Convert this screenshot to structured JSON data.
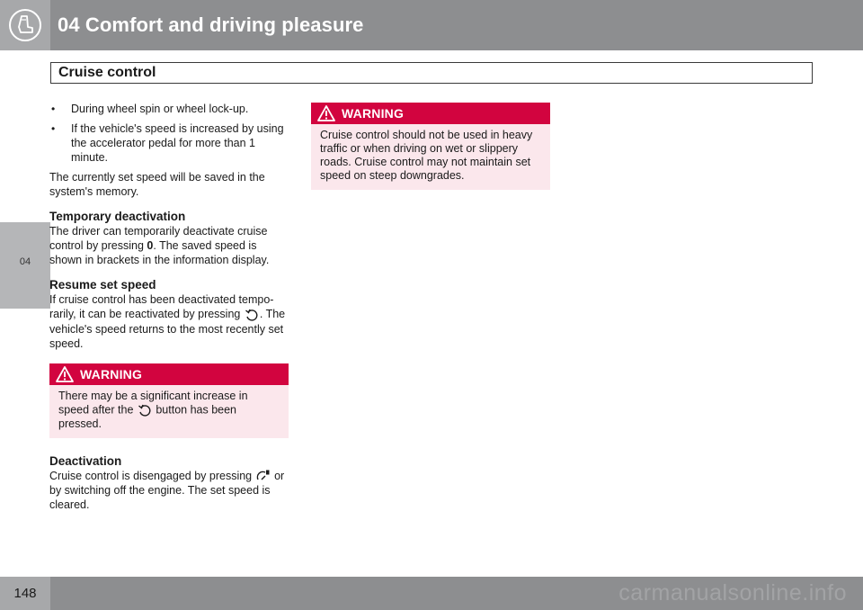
{
  "header": {
    "chapter_title": "04 Comfort and driving pleasure",
    "section_title": "Cruise control"
  },
  "side_tab": {
    "label": "04"
  },
  "footer": {
    "page_number": "148",
    "watermark": "carmanualsonline.info"
  },
  "column1": {
    "bullets": [
      "During wheel spin or wheel lock-up.",
      "If the vehicle's speed is increased by using the accelerator pedal for more than 1 minute."
    ],
    "memory_text": "The currently set speed will be saved in the system's memory.",
    "temporary": {
      "heading": "Temporary deactivation",
      "text_before": "The driver can temporarily deactivate cruise control by pressing ",
      "button": "0",
      "text_after": ". The saved speed is shown in brackets in the information display."
    },
    "resume": {
      "heading": "Resume set speed",
      "text_before": "If cruise control has been deactivated tempo-rarily, it can be reactivated by pressing ",
      "text_after": ". The vehicle's speed returns to the most recently set speed."
    },
    "warning": {
      "title": "WARNING",
      "text_before": "There may be a significant increase in speed after the ",
      "text_after": " button has been pressed."
    },
    "deactivation": {
      "heading": "Deactivation",
      "text_before": "Cruise control is disengaged by pressing ",
      "text_after": " or by switching off the engine. The set speed is cleared."
    }
  },
  "column2": {
    "warning": {
      "title": "WARNING",
      "text": "Cruise control should not be used in heavy traffic or when driving on wet or slippery roads. Cruise control may not maintain set speed on steep downgrades."
    }
  },
  "colors": {
    "warning_red": "#d2043f",
    "warning_bg": "#fbe7ec",
    "header_gray": "#8d8e90"
  },
  "icons": [
    "seat-icon",
    "resume-arrow-icon",
    "cruise-off-icon",
    "warning-triangle-icon"
  ]
}
